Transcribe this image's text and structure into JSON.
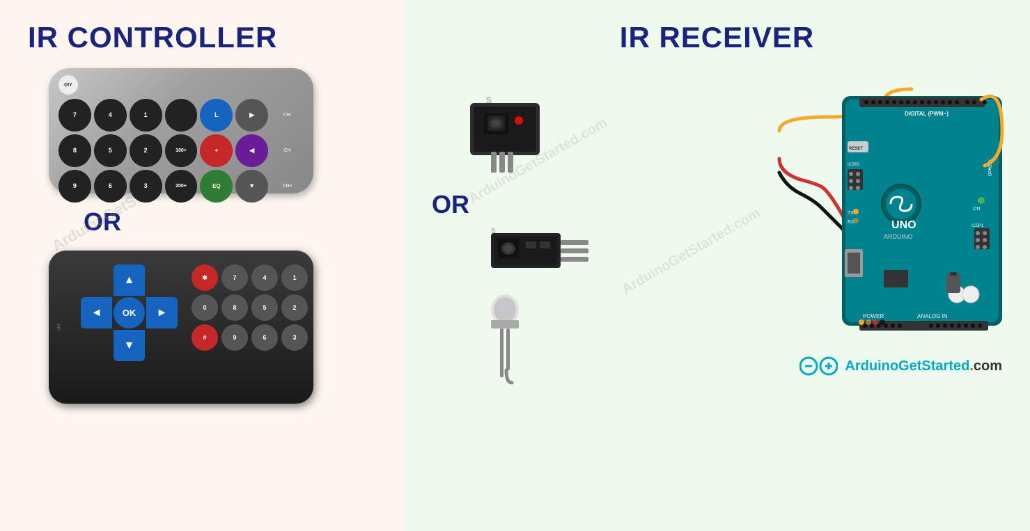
{
  "left": {
    "title": "IR CONTROLLER",
    "or_label": "OR",
    "remote1": {
      "buttons_row1": [
        "7",
        "4",
        "1",
        "",
        "L",
        "",
        "CH-"
      ],
      "buttons_row2": [
        "8",
        "5",
        "2",
        "100+",
        "+",
        "",
        "CH"
      ],
      "buttons_row3": [
        "9",
        "6",
        "3",
        "200+",
        "EQ",
        "",
        "CH+"
      ],
      "channel_labels": [
        "CH-",
        "CHANNEL",
        "CH+"
      ]
    },
    "remote2": {
      "dpad": {
        "up": "▲",
        "left": "◄",
        "ok": "OK",
        "right": "►",
        "down": "▼"
      },
      "numpad": [
        "*",
        "7",
        "4",
        "1",
        "0",
        "8",
        "5",
        "2",
        "#",
        "9",
        "6",
        "3"
      ]
    }
  },
  "right": {
    "title": "IR RECEIVER",
    "or_label": "OR",
    "brand": {
      "name": "ArduinoGetStarted",
      "domain": ".com",
      "watermark1": "ArduinoGetStarted.com",
      "watermark2": "ArduinoGetStarted.com"
    },
    "arduino": {
      "model": "UNO",
      "brand": "ARDUINO"
    }
  }
}
